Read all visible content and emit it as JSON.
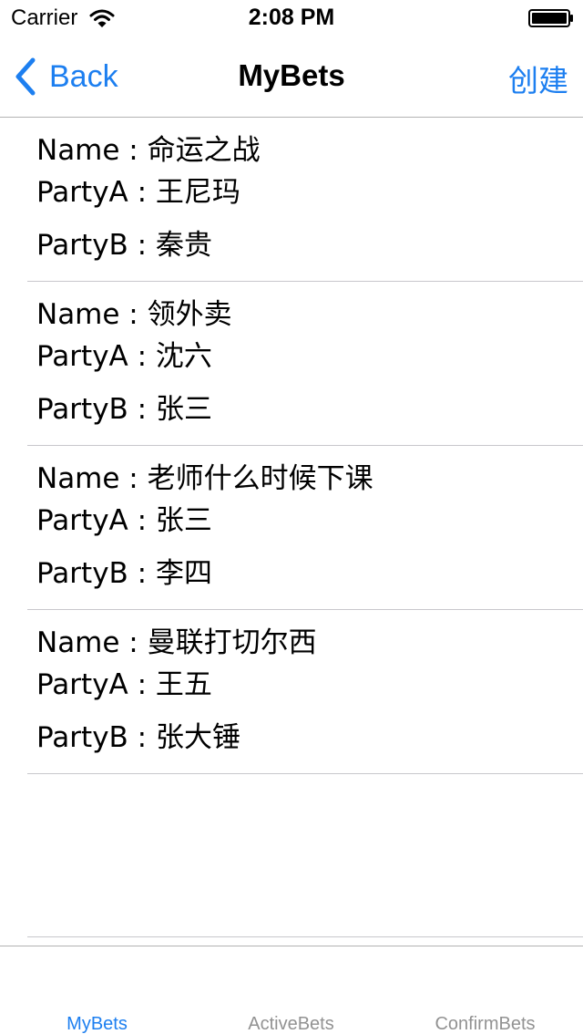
{
  "status_bar": {
    "carrier": "Carrier",
    "time": "2:08 PM",
    "icons": [
      "wifi-icon",
      "battery-icon"
    ]
  },
  "nav": {
    "back_label": "Back",
    "title": "MyBets",
    "right_button_label": "创建",
    "accent_color": "#1d7ff0"
  },
  "bets": [
    {
      "name": "Name : 命运之战",
      "party_a": "PartyA : 王尼玛",
      "party_b": "PartyB : 秦贵"
    },
    {
      "name": "Name : 领外卖",
      "party_a": "PartyA : 沈六",
      "party_b": "PartyB : 张三"
    },
    {
      "name": "Name : 老师什么时候下课",
      "party_a": "PartyA : 张三",
      "party_b": "PartyB : 李四"
    },
    {
      "name": "Name : 曼联打切尔西",
      "party_a": "PartyA : 王五",
      "party_b": "PartyB : 张大锤"
    }
  ],
  "tab_bar": {
    "tabs": [
      {
        "label": "MyBets",
        "active": true
      },
      {
        "label": "ActiveBets",
        "active": false
      },
      {
        "label": "ConfirmBets",
        "active": false
      }
    ],
    "active_color": "#1d7ff0",
    "inactive_color": "#929292"
  }
}
